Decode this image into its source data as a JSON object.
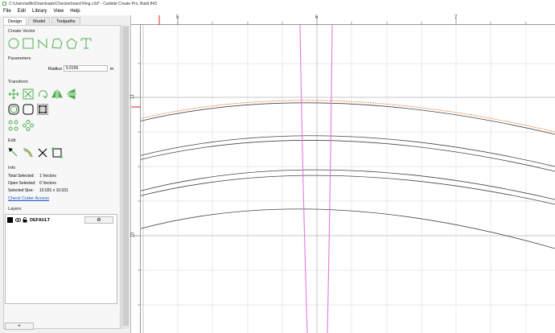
{
  "window": {
    "title": "C:\\Users\\wilfe\\Downloads\\Checkerboard Ring.c2d* - Carbide Create Pro, Build 843"
  },
  "menu": [
    "File",
    "Edit",
    "Library",
    "View",
    "Help"
  ],
  "tabs": [
    "Design",
    "Model",
    "Toolpaths"
  ],
  "sections": {
    "create_vector": "Create Vector",
    "parameters": "Parameters",
    "transform": "Transform",
    "edit": "Edit",
    "info": "Info",
    "layers": "Layers"
  },
  "parameters": {
    "label": "Radius",
    "value": "5.0156",
    "unit": "in"
  },
  "info": {
    "total_selected_label": "Total Selected:",
    "total_selected_value": "1 Vectors",
    "open_selected_label": "Open Selected:",
    "open_selected_value": "0 Vectors",
    "selected_size_label": "Selected Size:",
    "selected_size_value": "10.031 x 10.031",
    "check_cutter": "Check Cutter Access"
  },
  "layers": {
    "name": "DEFAULT",
    "settings_icon": "⚙",
    "add_label": "+"
  },
  "ruler": {
    "top": [
      "5",
      "6",
      "7"
    ],
    "left": [
      "11",
      "10"
    ]
  },
  "colors": {
    "accent": "#4caf50",
    "selection": "#e87a2a",
    "tool_guide": "#e07ae0",
    "vector": "#444444"
  }
}
